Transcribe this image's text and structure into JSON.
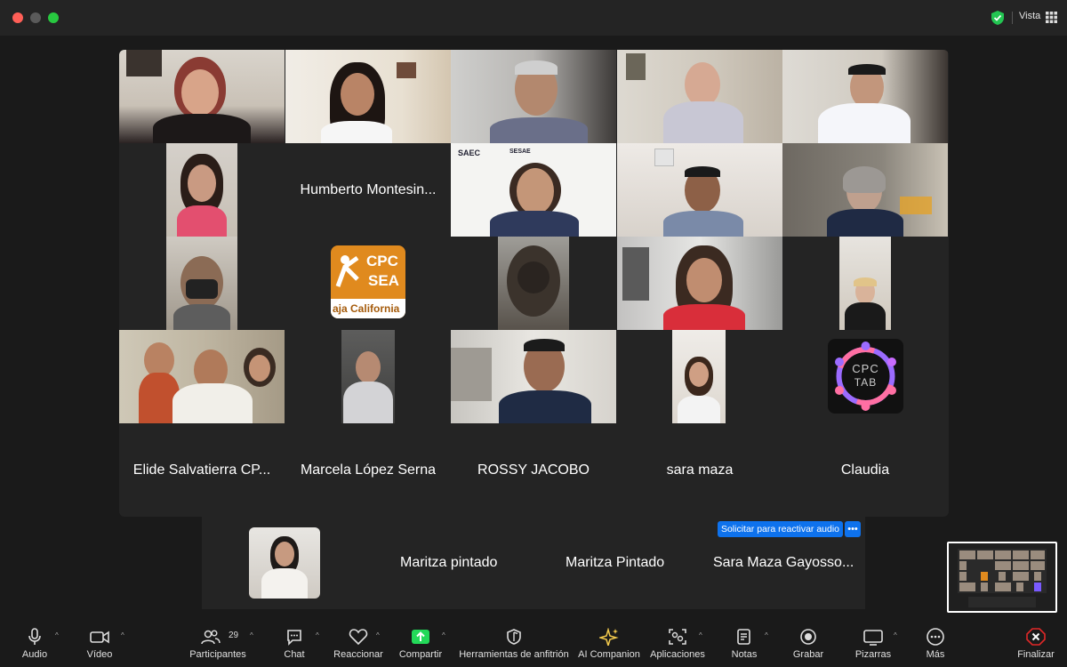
{
  "window": {
    "view_label": "Vista"
  },
  "gallery": {
    "name_tiles": [
      "Humberto Montesin...",
      "Elide Salvatierra CP...",
      "Marcela López Serna",
      "ROSSY JACOBO",
      "sara maza",
      "Claudia"
    ],
    "logos": {
      "cpc_sea_line1": "CPC",
      "cpc_sea_line2": "SEA",
      "cpc_sea_line3": "aja California",
      "cpc_tab_line1": "CPC",
      "cpc_tab_line2": "TAB",
      "saec": "SAEC",
      "sesae": "SESAE"
    }
  },
  "strip": {
    "names": [
      "Maritza pintado",
      "Maritza Pintado",
      "Sara Maza Gayosso..."
    ],
    "unmute_request": "Solicitar para reactivar audio",
    "more": "•••"
  },
  "toolbar": {
    "audio": "Audio",
    "video": "Vídeo",
    "participants": "Participantes",
    "participants_count": "29",
    "chat": "Chat",
    "react": "Reaccionar",
    "share": "Compartir",
    "host_tools": "Herramientas de anfitrión",
    "ai_companion": "AI Companion",
    "apps": "Aplicaciones",
    "notes": "Notas",
    "record": "Grabar",
    "whiteboards": "Pizarras",
    "more": "Más",
    "end": "Finalizar"
  },
  "colors": {
    "accent_blue": "#0e72ed",
    "active_speaker": "#2ba84a",
    "share_green": "#23d959",
    "end_red": "#e02828"
  }
}
